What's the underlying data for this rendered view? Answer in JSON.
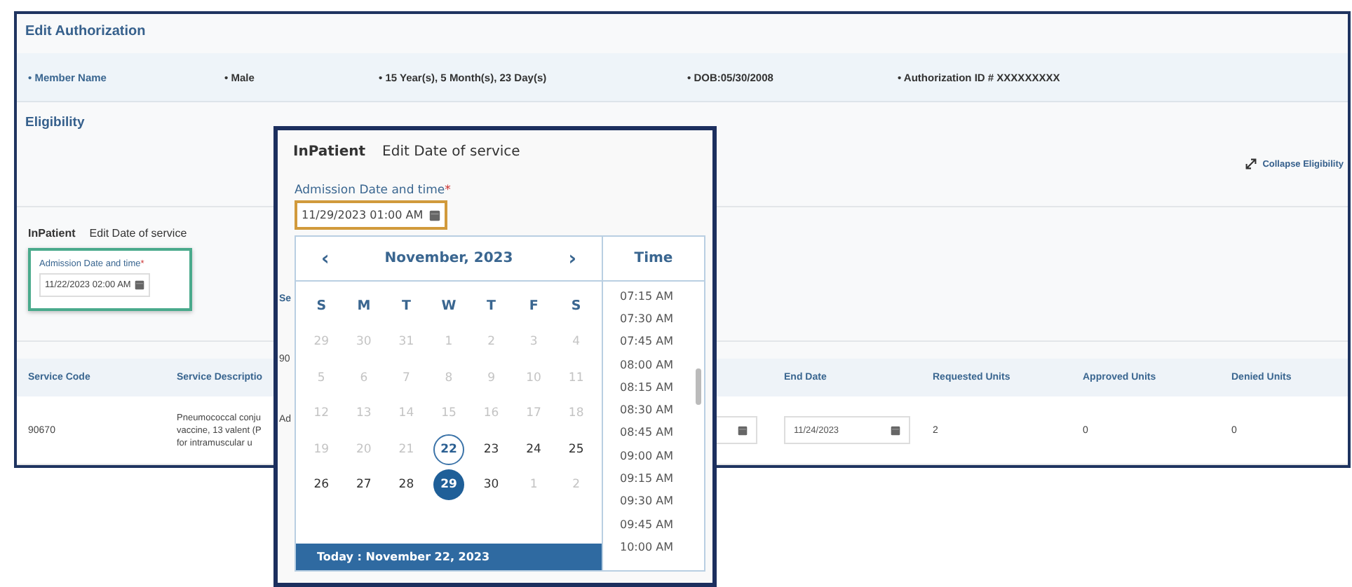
{
  "header": {
    "title": "Edit Authorization"
  },
  "member_info": [
    {
      "text": "• Member Name",
      "kind": "name"
    },
    {
      "text": "• Male",
      "kind": "info"
    },
    {
      "text": "• 15 Year(s), 5 Month(s), 23 Day(s)",
      "kind": "info"
    },
    {
      "text": "• DOB:05/30/2008",
      "kind": "info"
    },
    {
      "text": "• Authorization ID # XXXXXXXXX",
      "kind": "info"
    }
  ],
  "eligibility": {
    "title": "Eligibility",
    "collapse_link": "Collapse Eligibility"
  },
  "inpatient": {
    "tab": "InPatient",
    "edit_link": "Edit Date of service",
    "field": {
      "label": "Admission Date and time",
      "required_mark": "*",
      "value": "11/22/2023 02:00 AM",
      "highlighted": true
    }
  },
  "table": {
    "columns": [
      "Service Code",
      "Service Descriptio",
      "",
      "End Date",
      "Requested Units",
      "Approved Units",
      "Denied Units"
    ],
    "rows": [
      [
        {
          "kind": "text",
          "text": "90670"
        },
        {
          "kind": "lines",
          "lines": [
            "Pneumococcal conju",
            "vaccine, 13 valent (P",
            "for intramuscular u"
          ]
        },
        {
          "kind": "date"
        },
        {
          "kind": "date",
          "value": "11/24/2023"
        },
        {
          "kind": "text",
          "text": "2"
        },
        {
          "kind": "text",
          "text": "0"
        },
        {
          "kind": "text",
          "text": "0"
        }
      ]
    ]
  },
  "popup": {
    "tab": "InPatient",
    "edit_link": "Edit Date of service",
    "field": {
      "label": "Admission Date and time",
      "required_mark": "*",
      "value": "11/29/2023 01:00 AM",
      "focused": true
    },
    "fragments": [
      "Se",
      "90",
      "Ad"
    ],
    "calendar": {
      "prev": "‹",
      "month": "November, 2023",
      "next": "›",
      "weekdays": [
        "S",
        "M",
        "T",
        "W",
        "T",
        "F",
        "S"
      ],
      "days": [
        {
          "label": "29",
          "muted": true,
          "today": false,
          "selected": false
        },
        {
          "label": "30",
          "muted": true,
          "today": false,
          "selected": false
        },
        {
          "label": "31",
          "muted": true,
          "today": false,
          "selected": false
        },
        {
          "label": "1",
          "muted": true,
          "today": false,
          "selected": false
        },
        {
          "label": "2",
          "muted": true,
          "today": false,
          "selected": false
        },
        {
          "label": "3",
          "muted": true,
          "today": false,
          "selected": false
        },
        {
          "label": "4",
          "muted": true,
          "today": false,
          "selected": false
        },
        {
          "label": "5",
          "muted": true,
          "today": false,
          "selected": false
        },
        {
          "label": "6",
          "muted": true,
          "today": false,
          "selected": false
        },
        {
          "label": "7",
          "muted": true,
          "today": false,
          "selected": false
        },
        {
          "label": "8",
          "muted": true,
          "today": false,
          "selected": false
        },
        {
          "label": "9",
          "muted": true,
          "today": false,
          "selected": false
        },
        {
          "label": "10",
          "muted": true,
          "today": false,
          "selected": false
        },
        {
          "label": "11",
          "muted": true,
          "today": false,
          "selected": false
        },
        {
          "label": "12",
          "muted": true,
          "today": false,
          "selected": false
        },
        {
          "label": "13",
          "muted": true,
          "today": false,
          "selected": false
        },
        {
          "label": "14",
          "muted": true,
          "today": false,
          "selected": false
        },
        {
          "label": "15",
          "muted": true,
          "today": false,
          "selected": false
        },
        {
          "label": "16",
          "muted": true,
          "today": false,
          "selected": false
        },
        {
          "label": "17",
          "muted": true,
          "today": false,
          "selected": false
        },
        {
          "label": "18",
          "muted": true,
          "today": false,
          "selected": false
        },
        {
          "label": "19",
          "muted": true,
          "today": false,
          "selected": false
        },
        {
          "label": "20",
          "muted": true,
          "today": false,
          "selected": false
        },
        {
          "label": "21",
          "muted": true,
          "today": false,
          "selected": false
        },
        {
          "label": "22",
          "muted": false,
          "today": true,
          "selected": false
        },
        {
          "label": "23",
          "muted": false,
          "today": false,
          "selected": false
        },
        {
          "label": "24",
          "muted": false,
          "today": false,
          "selected": false
        },
        {
          "label": "25",
          "muted": false,
          "today": false,
          "selected": false
        },
        {
          "label": "26",
          "muted": false,
          "today": false,
          "selected": false
        },
        {
          "label": "27",
          "muted": false,
          "today": false,
          "selected": false
        },
        {
          "label": "28",
          "muted": false,
          "today": false,
          "selected": false
        },
        {
          "label": "29",
          "muted": false,
          "today": false,
          "selected": true
        },
        {
          "label": "30",
          "muted": false,
          "today": false,
          "selected": false
        },
        {
          "label": "1",
          "muted": true,
          "today": false,
          "selected": false
        },
        {
          "label": "2",
          "muted": true,
          "today": false,
          "selected": false
        }
      ],
      "today_bar": "Today : November 22, 2023"
    },
    "time": {
      "title": "Time",
      "options": [
        "07:15 AM",
        "07:30 AM",
        "07:45 AM",
        "08:00 AM",
        "08:15 AM",
        "08:30 AM",
        "08:45 AM",
        "09:00 AM",
        "09:15 AM",
        "09:30 AM",
        "09:45 AM",
        "10:00 AM"
      ]
    }
  }
}
